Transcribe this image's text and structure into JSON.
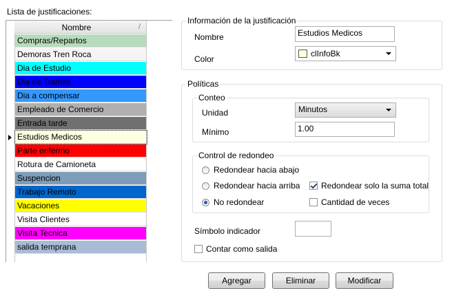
{
  "list": {
    "title": "Lista de justificaciones:",
    "column_header": "Nombre",
    "sort_glyph": "/",
    "selected_index": 8,
    "rows": [
      {
        "name": "Compras/Repartos",
        "bg": "#b7dcbd",
        "fg": "#000000"
      },
      {
        "name": "Demoras Tren Roca",
        "bg": "#f5f5f5",
        "fg": "#000000"
      },
      {
        "name": "Dia de Estudio",
        "bg": "#00ffff",
        "fg": "#000000"
      },
      {
        "name": "Dia de Tramite",
        "bg": "#0000ff",
        "fg": "#000000"
      },
      {
        "name": "Dia a compensar",
        "bg": "#3399ff",
        "fg": "#000000"
      },
      {
        "name": "Empleado de Comercio",
        "bg": "#b0b0b0",
        "fg": "#000000"
      },
      {
        "name": "Entrada tarde",
        "bg": "#707070",
        "fg": "#000000"
      },
      {
        "name": "Estudios Medicos",
        "bg": "#ffffe1",
        "fg": "#000000"
      },
      {
        "name": "Parte enfermo",
        "bg": "#ff0000",
        "fg": "#000000"
      },
      {
        "name": "Rotura de Camioneta",
        "bg": "#ffffff",
        "fg": "#000000"
      },
      {
        "name": "Suspencion",
        "bg": "#7f9db9",
        "fg": "#000000"
      },
      {
        "name": "Trabajo Remoto",
        "bg": "#0066cc",
        "fg": "#000000"
      },
      {
        "name": "Vacaciones",
        "bg": "#ffff00",
        "fg": "#000000"
      },
      {
        "name": "Visita Clientes",
        "bg": "#ffffff",
        "fg": "#000000"
      },
      {
        "name": "Visita Tecnica",
        "bg": "#ff00ff",
        "fg": "#000000"
      },
      {
        "name": "salida temprana",
        "bg": "#a9bcd5",
        "fg": "#000000"
      }
    ]
  },
  "info": {
    "title": "Información de la justificación",
    "name_label": "Nombre",
    "name_value": "Estudios Medicos",
    "color_label": "Color",
    "color_value": "clInfoBk",
    "color_swatch": "#ffffe1"
  },
  "policies": {
    "title": "Políticas",
    "conteo": {
      "title": "Conteo",
      "unit_label": "Unidad",
      "unit_value": "Minutos",
      "min_label": "Mínimo",
      "min_value": "1.00"
    },
    "rounding": {
      "title": "Control de redondeo",
      "radio_down": "Redondear hacia abajo",
      "radio_up": "Redondear hacia arriba",
      "radio_none": "No redondear",
      "check_total": "Redondear solo la suma total",
      "check_times": "Cantidad de veces"
    },
    "symbol_label": "Símbolo indicador",
    "symbol_value": "",
    "count_exit_label": "Contar como salida"
  },
  "buttons": {
    "add": "Agregar",
    "delete": "Eliminar",
    "modify": "Modificar"
  }
}
